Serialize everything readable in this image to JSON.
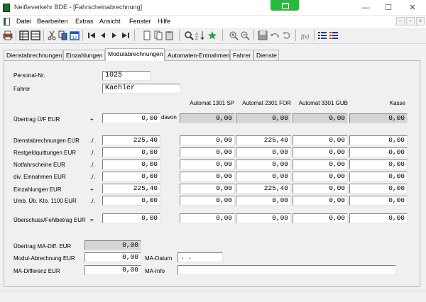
{
  "window": {
    "title": "Neißeverkehr BDE - [Fahrscheinabrechnung]",
    "controls": [
      "—",
      "☐",
      "✕"
    ]
  },
  "menu": {
    "items": [
      "Datei",
      "Bearbeiten",
      "Extras",
      "Ansicht",
      "Fenster",
      "Hilfe"
    ],
    "mdi_controls": [
      "–",
      "▫",
      "×"
    ]
  },
  "toolbar": {
    "icons": [
      "print-icon",
      "grid-icon",
      "grid-alt-icon",
      "cut-icon",
      "copy-icon",
      "calendar-icon",
      "first-record-icon",
      "prev-record-icon",
      "next-record-icon",
      "last-record-icon",
      "new-record-icon",
      "copy-record-icon",
      "paste-icon",
      "search-icon",
      "sort-az-icon",
      "star-icon",
      "zoom-in-icon",
      "zoom-out-icon",
      "save-icon",
      "undo-icon",
      "refresh-icon",
      "function-icon",
      "list-icon",
      "list-alt-icon"
    ]
  },
  "tabs": [
    {
      "label": "Dienstabrechnungen",
      "active": false
    },
    {
      "label": "Einzahlungen",
      "active": false
    },
    {
      "label": "Modulabrechnungen",
      "active": true
    },
    {
      "label": "Automaten-Entnahmen",
      "active": false
    },
    {
      "label": "Fahrer",
      "active": false
    },
    {
      "label": "Dienste",
      "active": false
    }
  ],
  "header_fields": {
    "personal_nr_label": "Personal-Nr.",
    "personal_nr_value": "1025",
    "fahrer_label": "Fahrer",
    "fahrer_value": "Kaehler"
  },
  "columns": [
    "Automat 1301 SP",
    "Automat 2301 FOR",
    "Automat 3301 GUB",
    "Kasse"
  ],
  "davon_label": "davon",
  "rows": [
    {
      "label": "Übertrag Ü/F EUR",
      "sym": "+",
      "main": "0,00",
      "cells": [
        "0,00",
        "0,00",
        "0,00",
        "0,00"
      ],
      "grey": true
    },
    {
      "label": "Dienstabrechnungen EUR",
      "sym": "./.",
      "main": "225,40",
      "cells": [
        "0,00",
        "225,40",
        "0,00",
        "0,00"
      ],
      "grey": false
    },
    {
      "label": "Restgeldquittungen EUR",
      "sym": "./.",
      "main": "0,00",
      "cells": [
        "0,00",
        "0,00",
        "0,00",
        "0,00"
      ],
      "grey": false
    },
    {
      "label": "Notfahrscheine EUR",
      "sym": "./.",
      "main": "0,00",
      "cells": [
        "0,00",
        "0,00",
        "0,00",
        "0,00"
      ],
      "grey": false
    },
    {
      "label": "div. Einnahmen EUR",
      "sym": "./.",
      "main": "0,00",
      "cells": [
        "0,00",
        "0,00",
        "0,00",
        "0,00"
      ],
      "grey": false
    },
    {
      "label": "Einzahlungen EUR",
      "sym": "+",
      "main": "225,40",
      "cells": [
        "0,00",
        "225,40",
        "0,00",
        "0,00"
      ],
      "grey": false
    },
    {
      "label": "Umb. Üb. Kto. 1100 EUR",
      "sym": "./.",
      "main": "0,00",
      "cells": [
        "0,00",
        "0,00",
        "0,00",
        "0,00"
      ],
      "grey": false
    },
    {
      "label": "Überschuss/Fehlbetrag EUR",
      "sym": "=",
      "main": "0,00",
      "cells": [
        "0,00",
        "0,00",
        "0,00",
        "0,00"
      ],
      "grey": false
    }
  ],
  "bottom": {
    "uebertrag_label": "Übertrag MA-Diff. EUR",
    "uebertrag_value": "0,00",
    "modul_label": "Modul-Abrechnung EUR",
    "modul_value": "0,00",
    "ma_datum_label": "MA-Datum",
    "ma_datum_value": ". .",
    "ma_diff_label": "MA-Differenz EUR",
    "ma_diff_value": "0,00",
    "ma_info_label": "MA-Info",
    "ma_info_value": ""
  }
}
